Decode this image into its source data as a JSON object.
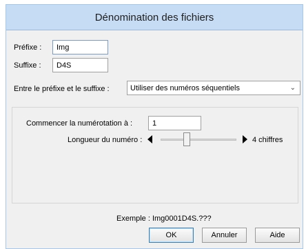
{
  "dialog": {
    "title": "Dénomination des fichiers"
  },
  "prefix": {
    "label": "Préfixe :",
    "value": "Img"
  },
  "suffix": {
    "label": "Suffixe :",
    "value": "D4S"
  },
  "between": {
    "label": "Entre le préfixe et le suffixe :",
    "selected": "Utiliser des numéros séquentiels"
  },
  "numbering": {
    "start_label": "Commencer la numérotation à :",
    "start_value": "1",
    "length_label": "Longueur du numéro :",
    "length_value": "4 chiffres",
    "length_fraction": 0.33
  },
  "example": {
    "text": "Exemple : Img0001D4S.???"
  },
  "buttons": {
    "ok": "OK",
    "cancel": "Annuler",
    "help": "Aide"
  }
}
